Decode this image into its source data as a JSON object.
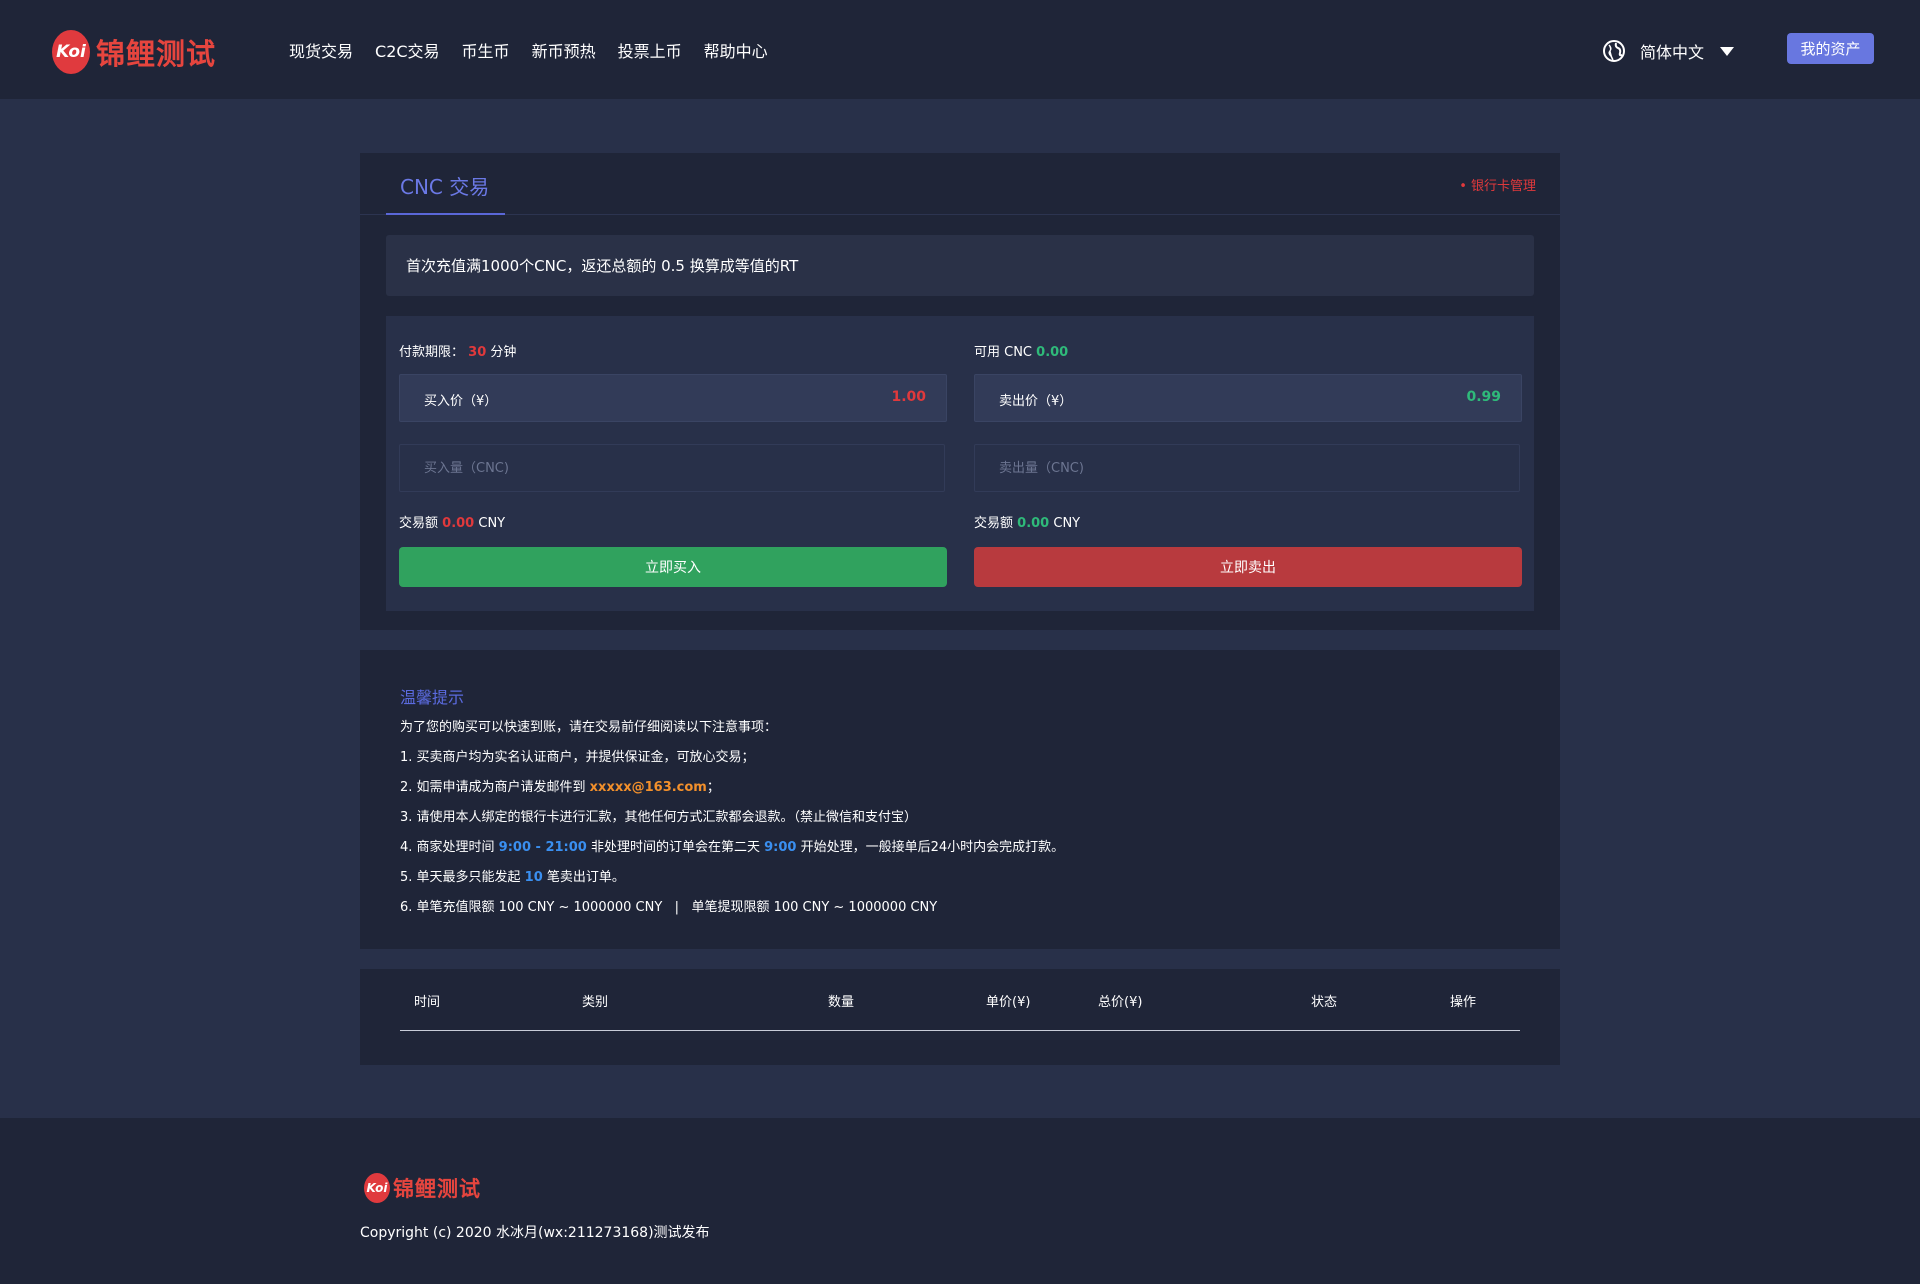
{
  "header": {
    "logo_badge": "Koi",
    "logo_text": "锦鲤测试",
    "nav": [
      "现货交易",
      "C2C交易",
      "币生币",
      "新币预热",
      "投票上币",
      "帮助中心"
    ],
    "language": "简体中文",
    "assets_button": "我的资产"
  },
  "trade": {
    "tab_title": "CNC 交易",
    "bank_link": "• 银行卡管理",
    "notice": "首次充值满1000个CNC，返还总额的 0.5 换算成等值的RT",
    "buy": {
      "limit_label": "付款期限：",
      "limit_value": "30",
      "limit_unit": "分钟",
      "price_label": "买入价（¥）",
      "price_value": "1.00",
      "qty_placeholder": "买入量（CNC)",
      "amount_label": "交易额",
      "amount_value": "0.00",
      "amount_unit": "CNY",
      "button": "立即买入"
    },
    "sell": {
      "avail_label": "可用 CNC",
      "avail_value": "0.00",
      "price_label": "卖出价（¥）",
      "price_value": "0.99",
      "qty_placeholder": "卖出量（CNC)",
      "amount_label": "交易额",
      "amount_value": "0.00",
      "amount_unit": "CNY",
      "button": "立即卖出"
    }
  },
  "tips": {
    "title": "温馨提示",
    "intro": "为了您的购买可以快速到账，请在交易前仔细阅读以下注意事项：",
    "line1": "1. 买卖商户均为实名认证商户，并提供保证金，可放心交易；",
    "line2_pre": "2. 如需申请成为商户请发邮件到 ",
    "line2_email": "xxxxx@163.com",
    "line2_post": "；",
    "line3": "3. 请使用本人绑定的银行卡进行汇款，其他任何方式汇款都会退款。（禁止微信和支付宝）",
    "line4_pre": "4. 商家处理时间 ",
    "line4_time": "9:00 - 21:00",
    "line4_mid": " 非处理时间的订单会在第二天 ",
    "line4_time2": "9:00",
    "line4_post": " 开始处理，一般接单后24小时内会完成打款。",
    "line5_pre": "5. 单天最多只能发起 ",
    "line5_num": "10",
    "line5_post": " 笔卖出订单。",
    "line6": "6. 单笔充值限额 100 CNY ~ 1000000 CNY   |   单笔提现限额 100 CNY ~ 1000000 CNY"
  },
  "table": {
    "headers": [
      "时间",
      "类别",
      "数量",
      "单价(¥)",
      "总价(¥)",
      "状态",
      "操作"
    ]
  },
  "footer": {
    "logo_badge": "Koi",
    "logo_text": "锦鲤测试",
    "copyright": "Copyright (c) 2020 水冰月(wx:211273168)测试发布"
  }
}
